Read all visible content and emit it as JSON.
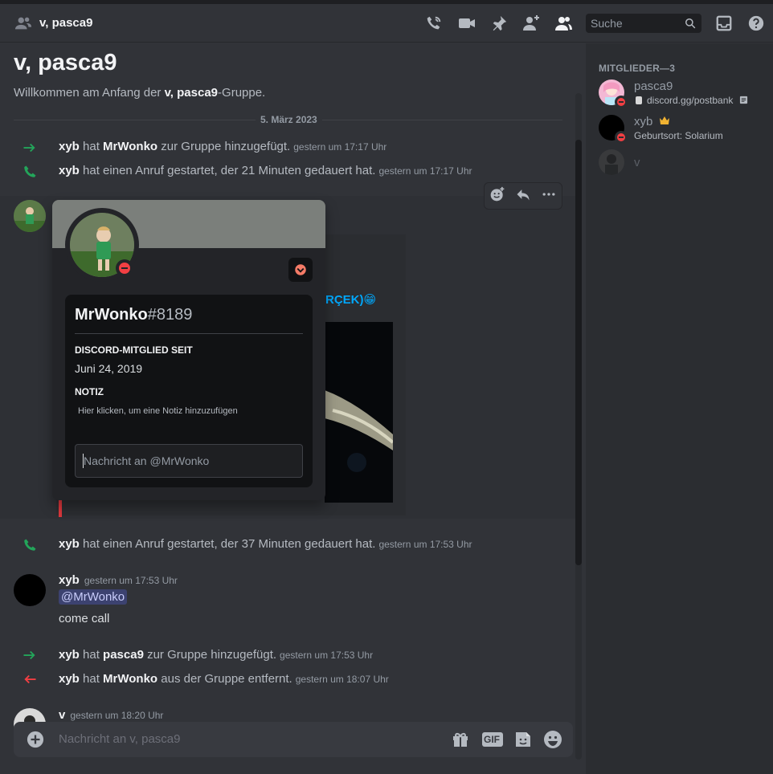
{
  "header": {
    "title": "v, pasca9",
    "search_placeholder": "Suche"
  },
  "channel": {
    "title": "v, pasca9",
    "welcome_prefix": "Willkommen am Anfang der ",
    "welcome_bold": "v, pasca9",
    "welcome_suffix": "-Gruppe.",
    "date_divider": "5. März 2023"
  },
  "messages": {
    "sys1": {
      "actor": "xyb",
      "verb": " hat ",
      "target": "MrWonko",
      "rest": " zur Gruppe hinzugefügt.",
      "time": "gestern um 17:17 Uhr"
    },
    "sys2": {
      "actor": "xyb",
      "rest": " hat einen Anruf gestartet, der 21 Minuten gedauert hat.",
      "time": "gestern um 17:17 Uhr"
    },
    "embed_fragment": "RÇEK)",
    "embed_emoji": "😁",
    "sys3": {
      "actor": "xyb",
      "rest": " hat einen Anruf gestartet, der 37 Minuten gedauert hat.",
      "time": "gestern um 17:53 Uhr"
    },
    "msg_xyb": {
      "author": "xyb",
      "time": "gestern um 17:53 Uhr",
      "mention": "@MrWonko",
      "text": "come call"
    },
    "sys4": {
      "actor": "xyb",
      "verb": " hat ",
      "target": "pasca9",
      "rest": " zur Gruppe hinzugefügt.",
      "time": "gestern um 17:53 Uhr"
    },
    "sys5": {
      "actor": "xyb",
      "verb": " hat ",
      "target": "MrWonko",
      "rest": " aus der Gruppe entfernt.",
      "time": "gestern um 18:07 Uhr"
    },
    "msg_v": {
      "author": "v",
      "time": "gestern um 18:20 Uhr"
    }
  },
  "profile": {
    "username": "MrWonko",
    "discriminator": "#8189",
    "member_since_label": "DISCORD-MITGLIED SEIT",
    "member_since": "Juni 24, 2019",
    "note_label": "NOTIZ",
    "note_placeholder": "Hier klicken, um eine Notiz hinzuzufügen",
    "dm_placeholder": "Nachricht an @MrWonko"
  },
  "composer": {
    "placeholder": "Nachricht an v, pasca9",
    "gif_label": "GIF"
  },
  "members": {
    "heading": "MITGLIEDER—3",
    "list": [
      {
        "name": "pasca9",
        "status_text": "discord.gg/postbank",
        "status": "dnd"
      },
      {
        "name": "xyb",
        "status_text": "Geburtsort: Solarium",
        "status": "dnd",
        "owner": true
      },
      {
        "name": "v",
        "status_text": "",
        "status": "offline"
      }
    ]
  },
  "colors": {
    "accent_link": "#00a8fc",
    "dnd": "#f23f43",
    "join_arrow": "#23a55a",
    "leave_arrow": "#f23f43",
    "crown": "#f0b232"
  }
}
